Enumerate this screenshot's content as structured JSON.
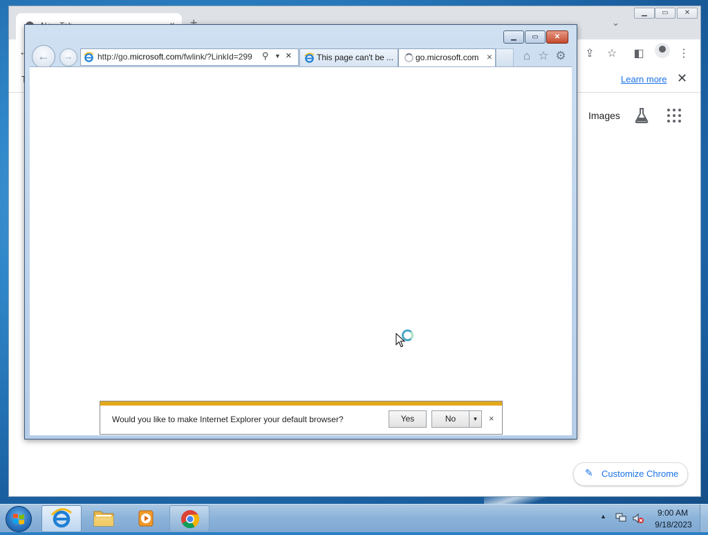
{
  "chrome": {
    "tab_title": "New Tab",
    "tab_close": "×",
    "new_tab": "+",
    "tab_search": "⌄",
    "info_letter": "T",
    "learn_more": "Learn more",
    "info_close": "✕",
    "images_link": "Images",
    "customize_label": "Customize Chrome",
    "customize_icon": "✎",
    "toolbar_icons": {
      "share": "⇪",
      "bookmark": "☆",
      "sidepanel": "◧",
      "menu": "⋮"
    }
  },
  "ie": {
    "address_url_prefix": "http://go.",
    "address_url_domain": "microsoft.com",
    "address_url_rest": "/fwlink/?LinkId=299",
    "tabs": [
      {
        "title": "This page can't be ...",
        "close": ""
      },
      {
        "title": "go.microsoft.com",
        "close": "×"
      }
    ],
    "window_buttons": {
      "min": "▁",
      "max": "▭",
      "close": "✕"
    },
    "notification": {
      "text": "Would you like to make Internet Explorer your default browser?",
      "yes": "Yes",
      "no": "No",
      "dropdown": "▼",
      "close": "×"
    },
    "accent_color": "#e3a91c"
  },
  "taskbar": {
    "time": "9:00 AM",
    "date": "9/18/2023",
    "items": [
      "internet-explorer",
      "file-explorer",
      "media-player",
      "google-chrome"
    ]
  }
}
